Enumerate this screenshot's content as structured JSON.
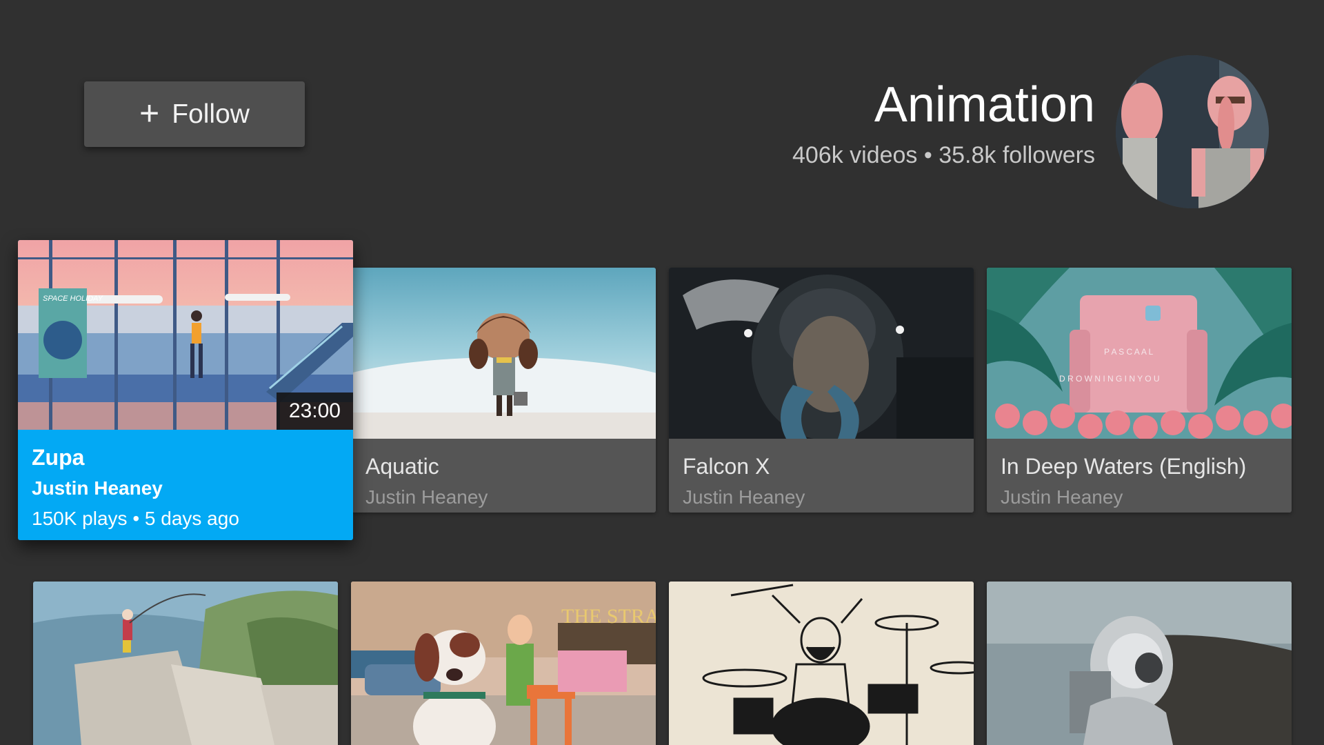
{
  "header": {
    "follow_label": "Follow",
    "channel_title": "Animation",
    "channel_stats": "406k videos • 35.8k followers"
  },
  "videos": [
    {
      "title": "Zupa",
      "author": "Justin Heaney",
      "meta": "150K plays • 5 days ago",
      "duration": "23:00"
    },
    {
      "title": "Aquatic",
      "author": "Justin Heaney"
    },
    {
      "title": "Falcon X",
      "author": "Justin Heaney"
    },
    {
      "title": "In Deep Waters (English)",
      "author": "Justin Heaney"
    }
  ],
  "thumb_text": {
    "space_holiday": "SPACE HOLIDAY",
    "pascaal": "P A S C A A L",
    "drowning": "D R O W N I N G   I N   Y O U",
    "straight": "THE STRAIGHT S"
  },
  "colors": {
    "background": "#303030",
    "focus_accent": "#03a9f4",
    "card": "#555555"
  }
}
